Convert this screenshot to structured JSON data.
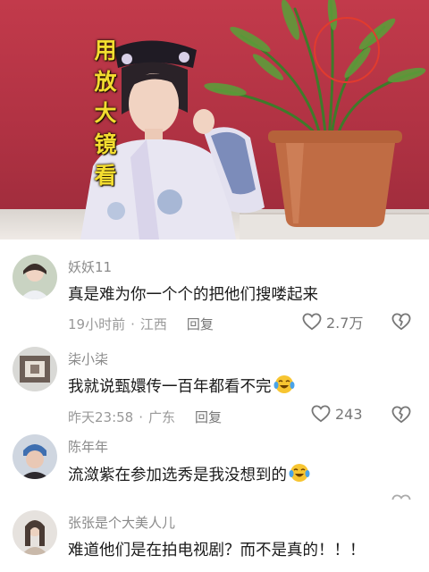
{
  "video": {
    "overlay_chars": [
      "用",
      "放",
      "大",
      "镜",
      "看"
    ]
  },
  "comments": [
    {
      "username": "妖妖11",
      "text": "真是难为你一个个的把他们搜喽起来",
      "time": "19小时前",
      "location": "江西",
      "reply": "回复",
      "likes": "2.7万"
    },
    {
      "username": "柒小柒",
      "text": "我就说甄嬛传一百年都看不完",
      "emoji": "crying-laughing-emoji",
      "time": "昨天23:58",
      "location": "广东",
      "reply": "回复",
      "likes": "243"
    },
    {
      "username": "陈年年",
      "text": "流潋紫在参加选秀是我没想到的",
      "emoji": "crying-laughing-emoji"
    },
    {
      "username": "张张是个大美人儿",
      "text": "难道他们是在拍电视剧？而不是真的！！！"
    }
  ],
  "colors": {
    "video_bg": "#b03243",
    "overlay_text": "#f3dd30",
    "username": "#8a8a8a",
    "comment_text": "#1a1a1a",
    "meta": "#999999"
  }
}
